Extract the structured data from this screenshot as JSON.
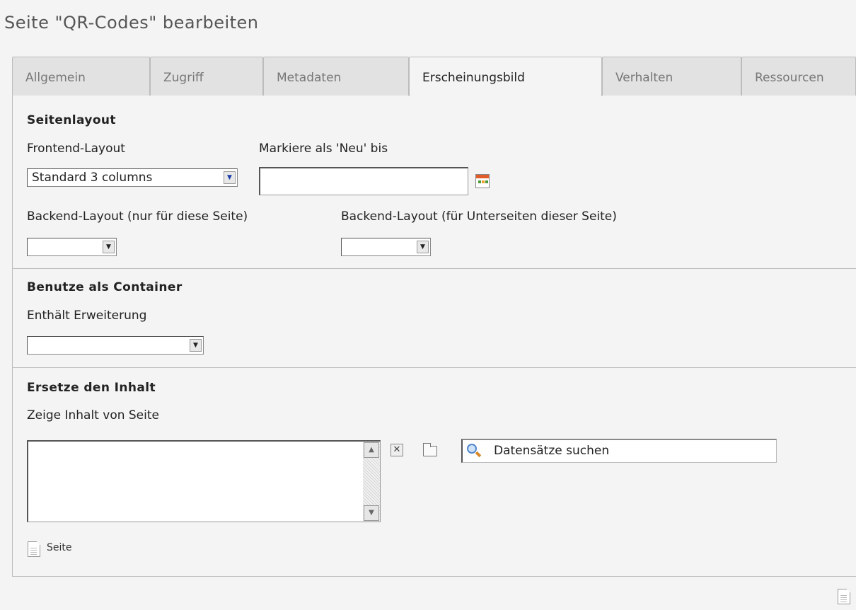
{
  "page": {
    "title": "Seite \"QR-Codes\" bearbeiten"
  },
  "tabs": [
    {
      "label": "Allgemein",
      "active": false
    },
    {
      "label": "Zugriff",
      "active": false
    },
    {
      "label": "Metadaten",
      "active": false
    },
    {
      "label": "Erscheinungsbild",
      "active": true
    },
    {
      "label": "Verhalten",
      "active": false
    },
    {
      "label": "Ressourcen",
      "active": false
    }
  ],
  "seitenlayout": {
    "heading": "Seitenlayout",
    "frontend_layout": {
      "label": "Frontend-Layout",
      "value": "Standard 3 columns"
    },
    "markiere_neu": {
      "label": "Markiere als 'Neu' bis",
      "value": ""
    },
    "backend_layout_page": {
      "label": "Backend-Layout (nur für diese Seite)",
      "value": ""
    },
    "backend_layout_sub": {
      "label": "Backend-Layout (für Unterseiten dieser Seite)",
      "value": ""
    }
  },
  "container": {
    "heading": "Benutze als Container",
    "enthaelt": {
      "label": "Enthält Erweiterung",
      "value": ""
    }
  },
  "ersetze": {
    "heading": "Ersetze den Inhalt",
    "zeige": {
      "label": "Zeige Inhalt von Seite"
    },
    "search_placeholder": "Datensätze suchen",
    "record_type": "Seite"
  },
  "icons": {
    "calendar": "calendar-icon",
    "remove": "close-icon",
    "browse": "folder-icon",
    "search": "search-icon",
    "page": "page-icon"
  }
}
